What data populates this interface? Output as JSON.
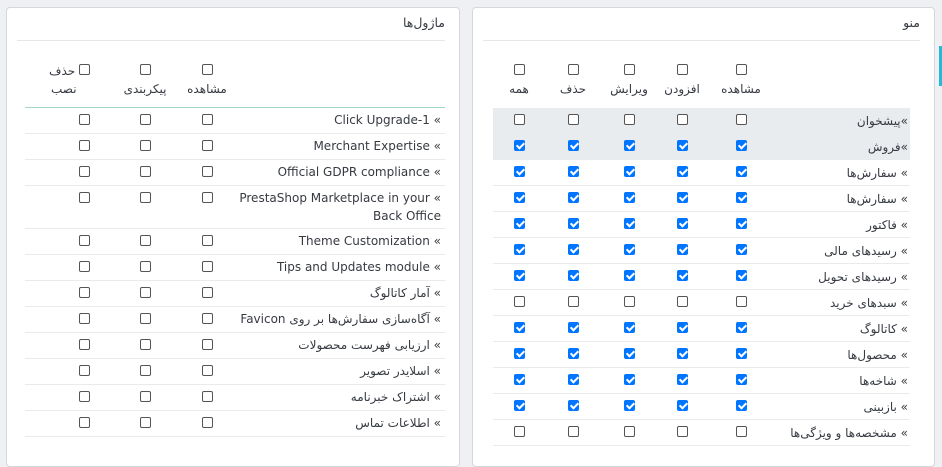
{
  "menu_panel": {
    "title": "منو",
    "headers": [
      "مشاهده",
      "افزودن",
      "ویرایش",
      "حذف",
      "همه"
    ],
    "rows": [
      {
        "label": "»پیشخوان",
        "checks": [
          false,
          false,
          false,
          false,
          false
        ],
        "shade": true
      },
      {
        "label": "»فروش",
        "checks": [
          true,
          true,
          true,
          true,
          true
        ],
        "shade": true
      },
      {
        "label": "» سفارش‌ها",
        "checks": [
          true,
          true,
          true,
          true,
          true
        ]
      },
      {
        "label": "» سفارش‌ها",
        "checks": [
          true,
          true,
          true,
          true,
          true
        ]
      },
      {
        "label": "» فاکتور",
        "checks": [
          true,
          true,
          true,
          true,
          true
        ]
      },
      {
        "label": "» رسیدهای مالی",
        "checks": [
          true,
          true,
          true,
          true,
          true
        ]
      },
      {
        "label": "» رسیدهای تحویل",
        "checks": [
          true,
          true,
          true,
          true,
          true
        ]
      },
      {
        "label": "» سبدهای خرید",
        "checks": [
          false,
          false,
          false,
          false,
          false
        ]
      },
      {
        "label": "» کاتالوگ",
        "checks": [
          true,
          true,
          true,
          true,
          true
        ]
      },
      {
        "label": "» محصول‌ها",
        "checks": [
          true,
          true,
          true,
          true,
          true
        ]
      },
      {
        "label": "» شاخه‌ها",
        "checks": [
          true,
          true,
          true,
          true,
          true
        ]
      },
      {
        "label": "» بازبینی",
        "checks": [
          true,
          true,
          true,
          true,
          true
        ]
      },
      {
        "label": "» مشخصه‌ها و ویژگی‌ها",
        "checks": [
          false,
          false,
          false,
          false,
          false
        ]
      }
    ]
  },
  "modules_panel": {
    "title": "ماژول‌ها",
    "headers": [
      "مشاهده",
      "پیکربندی",
      "حذف",
      "نصب"
    ],
    "rows": [
      {
        "label": "» Click Upgrade-1"
      },
      {
        "label": "» Merchant Expertise"
      },
      {
        "label": "» Official GDPR compliance"
      },
      {
        "label": "» PrestaShop Marketplace in your Back Office",
        "tall": true
      },
      {
        "label": "» Theme Customization"
      },
      {
        "label": "» Tips and Updates module"
      },
      {
        "label": "» آمار کاتالوگ"
      },
      {
        "label": "» آگاه‌سازی سفارش‌ها بر روی Favicon"
      },
      {
        "label": "» ارزیابی فهرست محصولات"
      },
      {
        "label": "» اسلایدر تصویر"
      },
      {
        "label": "» اشتراک خبرنامه"
      },
      {
        "label": "» اطلاعات تماس"
      }
    ]
  }
}
